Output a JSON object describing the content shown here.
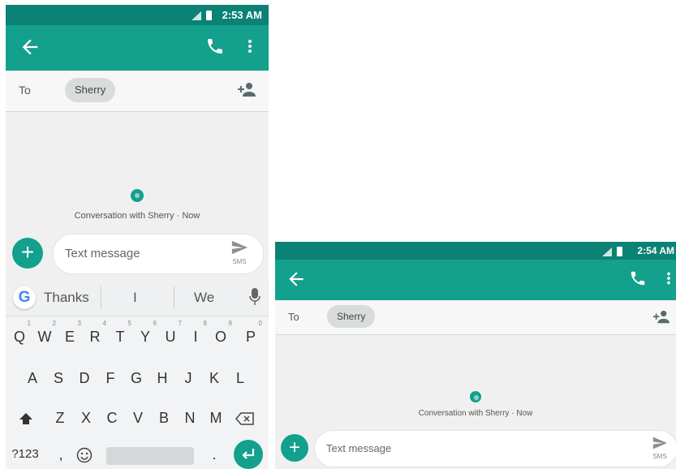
{
  "screens": [
    {
      "status": {
        "time": "2:53 AM"
      },
      "to_label": "To",
      "recipient": "Sherry",
      "conversation_label": "Conversation with Sherry · Now",
      "composer": {
        "placeholder": "Text message",
        "send_label": "SMS"
      },
      "keyboard": {
        "suggestions": [
          "Thanks",
          "I",
          "We"
        ],
        "row1": [
          "Q",
          "W",
          "E",
          "R",
          "T",
          "Y",
          "U",
          "I",
          "O",
          "P"
        ],
        "row1_hints": [
          "1",
          "2",
          "3",
          "4",
          "5",
          "6",
          "7",
          "8",
          "9",
          "0"
        ],
        "row2": [
          "A",
          "S",
          "D",
          "F",
          "G",
          "H",
          "J",
          "K",
          "L"
        ],
        "row3": [
          "Z",
          "X",
          "C",
          "V",
          "B",
          "N",
          "M"
        ],
        "symbols_label": "?123",
        "comma": ",",
        "period": "."
      }
    },
    {
      "status": {
        "time": "2:54 AM"
      },
      "to_label": "To",
      "recipient": "Sherry",
      "conversation_label": "Conversation with Sherry · Now",
      "composer": {
        "placeholder": "Text message",
        "send_label": "SMS"
      }
    }
  ],
  "colors": {
    "status_bar": "#0b8275",
    "app_bar": "#13a08d",
    "accent": "#13a08d",
    "chip": "#d8dcdc"
  },
  "icons": [
    "back-arrow-icon",
    "phone-icon",
    "more-vert-icon",
    "add-person-icon",
    "plus-icon",
    "send-icon",
    "google-g-icon",
    "mic-icon",
    "shift-icon",
    "backspace-icon",
    "emoji-icon",
    "enter-icon",
    "signal-icon",
    "battery-icon"
  ]
}
